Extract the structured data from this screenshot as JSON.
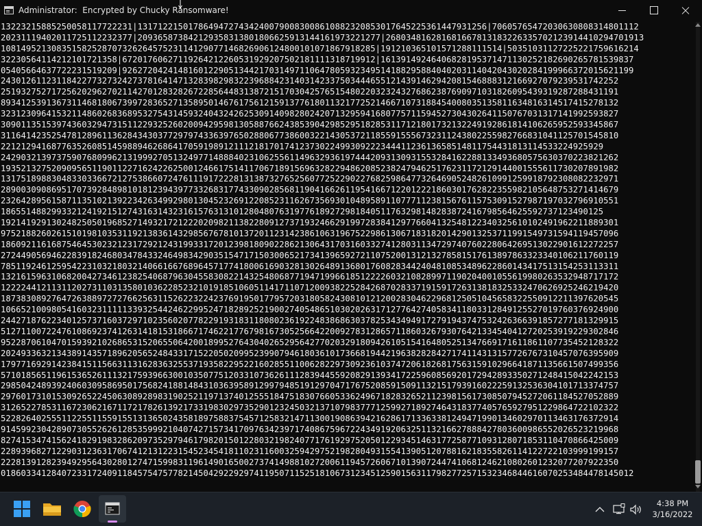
{
  "window": {
    "title": "Administrator:  Encrypted by Chucky Ransomware!",
    "controls": {
      "minimize": "minimize",
      "maximize": "maximize",
      "close": "close"
    }
  },
  "console": {
    "lines": [
      "13223215885250058117722231|131712215017864947274342400790083008610882320853017645225361447931256|70605765472030630808314801112",
      "20231119402011725112232377|209365873842129358313801806625913144161973221277|268034816281681667813183226335702123914410294701913",
      "10814952130835158252870732626457523114129077146826906124800101071867918285|191210365101571288111514|50351031127225221759616214",
      "32230564114212101721358|67201760627119264212260531929207502181111318719912|16139149246406828195371471130252182690265781539837",
      "05405664637722231519209|92627204241481601229051344217031497110647805932349514188295884040203114042043020284199966372015621199",
      "24301261123118422773273242737816414713283982983223968842314031423375034446551214391462942081546888312166927079239531742252",
      "25193275271725620296270211427012832826722856448313872151703042576515480220323243276862387690971031826095439319287288431191",
      "89341253913673114681806739972836527135895014676175612159137761801132177252146671073188454008035135811634816314517415278132",
      "32312309641532114860268368953275431459324043242625309140982802420713295941680775711594527304302641150767031317141992593827",
      "30901135153974360329473151122932526020094295981305887662438539042985295182853117121801732132249192861814106265952593345867",
      "31164142352547812896113628434303772979743363976502880677386003221430537211855915556732311243802255982766831041125701545810",
      "22121294168776352608514598894626864170591989121112181701741237302249930922234441123613658514811754431813114533224925929",
      "24290321397375907680996213199927051324977148884023106255611496329361974442093130931553284162288133493680575630370223821262",
      "19352132752090956511901122716242262500124661751411706718915696328229486208523824794625176231172129144001555611730207891982",
      "13175189883048330336672127538660724761119172228131387327652560772522902276825986477326469052482610991259918792308082232971",
      "28900309086951707392848981018123943977332683177433090285681190416626119541667122012221860301762822355982105648753271414679",
      "23264289561587113510213922342634992980130452326912208523116267356930104895891107771123815676115753091527987197032796910551",
      "18655148829933212419215127431631432316157631310128048076319776189272981840511763298148283872416798564625592737123490125",
      "19214192913024825050196852714932172122202098211382280912737193246629199728384129776604132548122340325610102491962211889301",
      "97521882602615101981035311921383614329856767810137201123142386106319675229861306718318201429013253711991549731594119457096",
      "18609211616875464530232123172921243199331720123981809022862130643170316033274128031134729740760228064269513022901612272257",
      "27244905694622839182468034784332464983429035154717150300652173413965927211075200131213278581517613897863323340106211760119",
      "78511924612595422310321803214066166768964571774180061690328130264891368017608283442404810853489622860143417513154253113311",
      "13216159631068200427346123825406879630455830822143254806877194719966185122226032108289971190204001055619980263532948717172",
      "12222441211311202731103135801036228523210191851060511417110712009382252842687028337191591726313818325332470626925246219420",
      "18738308927647263889727276625631152622322423769195017795720318058243081012120028304622968125051045658322550912211397620545",
      "10665210098054160323111113393254424622995247182892521900274054865103020263171277642740583411803312849125527019760376924900",
      "24427187622340125737160372971023560207782291931831180802361922483868630378253434949172791943747532426366391857277181329915",
      "51271100722476108692374126314181531866717462217767981673052566422009278312865711860326793076421334540412720253919229302846",
      "95228706104701593921026865315206550642001899527643040265295642770203291809426105154164805251347669171611861107735452128322",
      "20249336321343891435718962056524843317152205020995239907946180361017366819442196382828427174114313157726767310457076395909",
      "17977169291423841511566311316283632553719358229522160285511006282297309236103747206182681756315910296641871135661507499356",
      "57101856511961536526111321759396630010350775120331073626111283944559208291393417225960856920172942893350271248415042242153",
      "29850424893924060309586950175682418814843103639589129979485191297047176752085915091132151793916022259132536304101713374757",
      "29760173101530926522450630892898319025211971374012555184751830766053362496718283265211239815617308507945272061184527052889",
      "31265227853116723062167117217826139217331983029735290123245032137107983777125992718927464318377405765927951229864722102322",
      "52282640255511225511559155131365024358189758837545712583214711300190863942162861713363381249471990134602970113463176372914",
      "91459923042890730552626128535999210407427157341709763423971740867596722434919206325113216627888427803600986552026523219968",
      "82741534741562418291983286209735297946179820150122803219824077176192975205012293451463177258771093128071853110470866425009",
      "22893968271229031236317067412131223154523454181102311600325942975219828049315541390512078816218355826114122722103999199157",
      "22281391282394929564302801274715998311961490165002737414988102720061194572606710139072447410681246210802601232077207922350",
      "01860334128407233172409118457547577821450429229297411950711525181067312345125901563117982772571532346844616070253484478145012"
    ]
  },
  "taskbar": {
    "items": [
      {
        "name": "start-icon",
        "label": "Start"
      },
      {
        "name": "file-explorer-icon",
        "label": "File Explorer"
      },
      {
        "name": "chrome-icon",
        "label": "Google Chrome"
      },
      {
        "name": "terminal-icon",
        "label": "Administrator: Encrypted by Chucky Ransomware!"
      }
    ],
    "tray": {
      "chevron_icon": "chevron-up-icon",
      "network_icon": "network-icon",
      "volume_icon": "volume-icon"
    },
    "clock": {
      "time": "4:38 PM",
      "date": "3/16/2022"
    }
  },
  "colors": {
    "console_bg": "#0c0c0c",
    "console_fg": "#f2f2f2",
    "taskbar_bg": "#1c2128",
    "active_indicator": "#d78cf0"
  }
}
